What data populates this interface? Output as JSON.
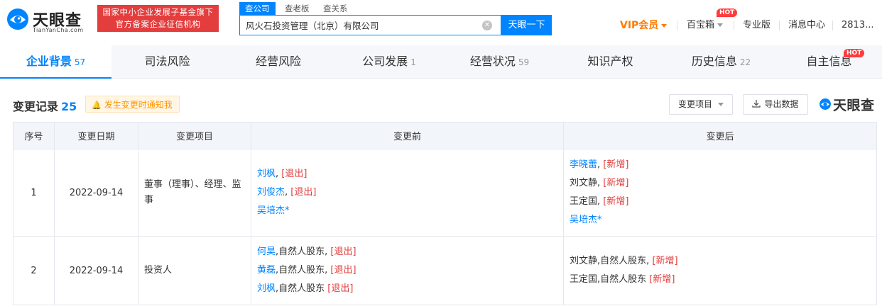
{
  "header": {
    "logo_cn": "天眼查",
    "logo_en": "TianYanCha.com",
    "gov_banner": [
      "国家中小企业发展子基金旗下",
      "官方备案企业征信机构"
    ],
    "search_tabs": [
      "查公司",
      "查老板",
      "查关系"
    ],
    "search_value": "风火石投资管理（北京）有限公司",
    "search_button": "天眼一下",
    "vip_label": "VIP会员",
    "box_label": "百宝箱",
    "hot_badge": "HOT",
    "pro_label": "专业版",
    "msg_label": "消息中心",
    "user_label": "2813..."
  },
  "tabs": [
    {
      "label": "企业背景",
      "count": "57"
    },
    {
      "label": "司法风险",
      "count": ""
    },
    {
      "label": "经营风险",
      "count": ""
    },
    {
      "label": "公司发展",
      "count": "1"
    },
    {
      "label": "经营状况",
      "count": "59"
    },
    {
      "label": "知识产权",
      "count": ""
    },
    {
      "label": "历史信息",
      "count": "22"
    },
    {
      "label": "自主信息",
      "count": ""
    }
  ],
  "tab_hot_badge": "HOT",
  "section": {
    "title": "变更记录",
    "count": "25",
    "notify_label": "发生变更时通知我",
    "filter_label": "变更项目",
    "export_label": "导出数据",
    "watermark": "天眼查"
  },
  "table": {
    "headers": [
      "序号",
      "变更日期",
      "变更项目",
      "变更前",
      "变更后"
    ],
    "rows": [
      {
        "no": "1",
        "date": "2022-09-14",
        "item": "董事（理事）、经理、监事",
        "before": [
          {
            "name": "刘枫",
            "rest": ",",
            "tag": "[退出]"
          },
          {
            "name": "刘俊杰",
            "rest": ",",
            "tag": "[退出]"
          },
          {
            "name": "吴培杰*",
            "rest": "",
            "tag": ""
          }
        ],
        "after": [
          {
            "name": "李晓蕾",
            "rest": ",",
            "tag": "[新增]",
            "linked": true
          },
          {
            "name": "刘文静",
            "rest": ",",
            "tag": "[新增]",
            "linked": false
          },
          {
            "name": "王定国",
            "rest": ",",
            "tag": "[新增]",
            "linked": false
          },
          {
            "name": "吴培杰*",
            "rest": "",
            "tag": "",
            "linked": true
          }
        ]
      },
      {
        "no": "2",
        "date": "2022-09-14",
        "item": "投资人",
        "before": [
          {
            "name": "何昊",
            "rest": ",自然人股东,",
            "tag": "[退出]"
          },
          {
            "name": "黄磊",
            "rest": ",自然人股东,",
            "tag": "[退出]"
          },
          {
            "name": "刘枫",
            "rest": ",自然人股东",
            "tag": "[退出]"
          }
        ],
        "after": [
          {
            "name": "刘文静",
            "rest": ",自然人股东,",
            "tag": "[新增]",
            "linked": false
          },
          {
            "name": "王定国",
            "rest": ",自然人股东",
            "tag": "[新增]",
            "linked": false
          }
        ]
      }
    ]
  },
  "colors": {
    "primary": "#0084ff",
    "danger": "#e33d3d",
    "vip": "#ff7a00",
    "notify": "#ff9400"
  }
}
